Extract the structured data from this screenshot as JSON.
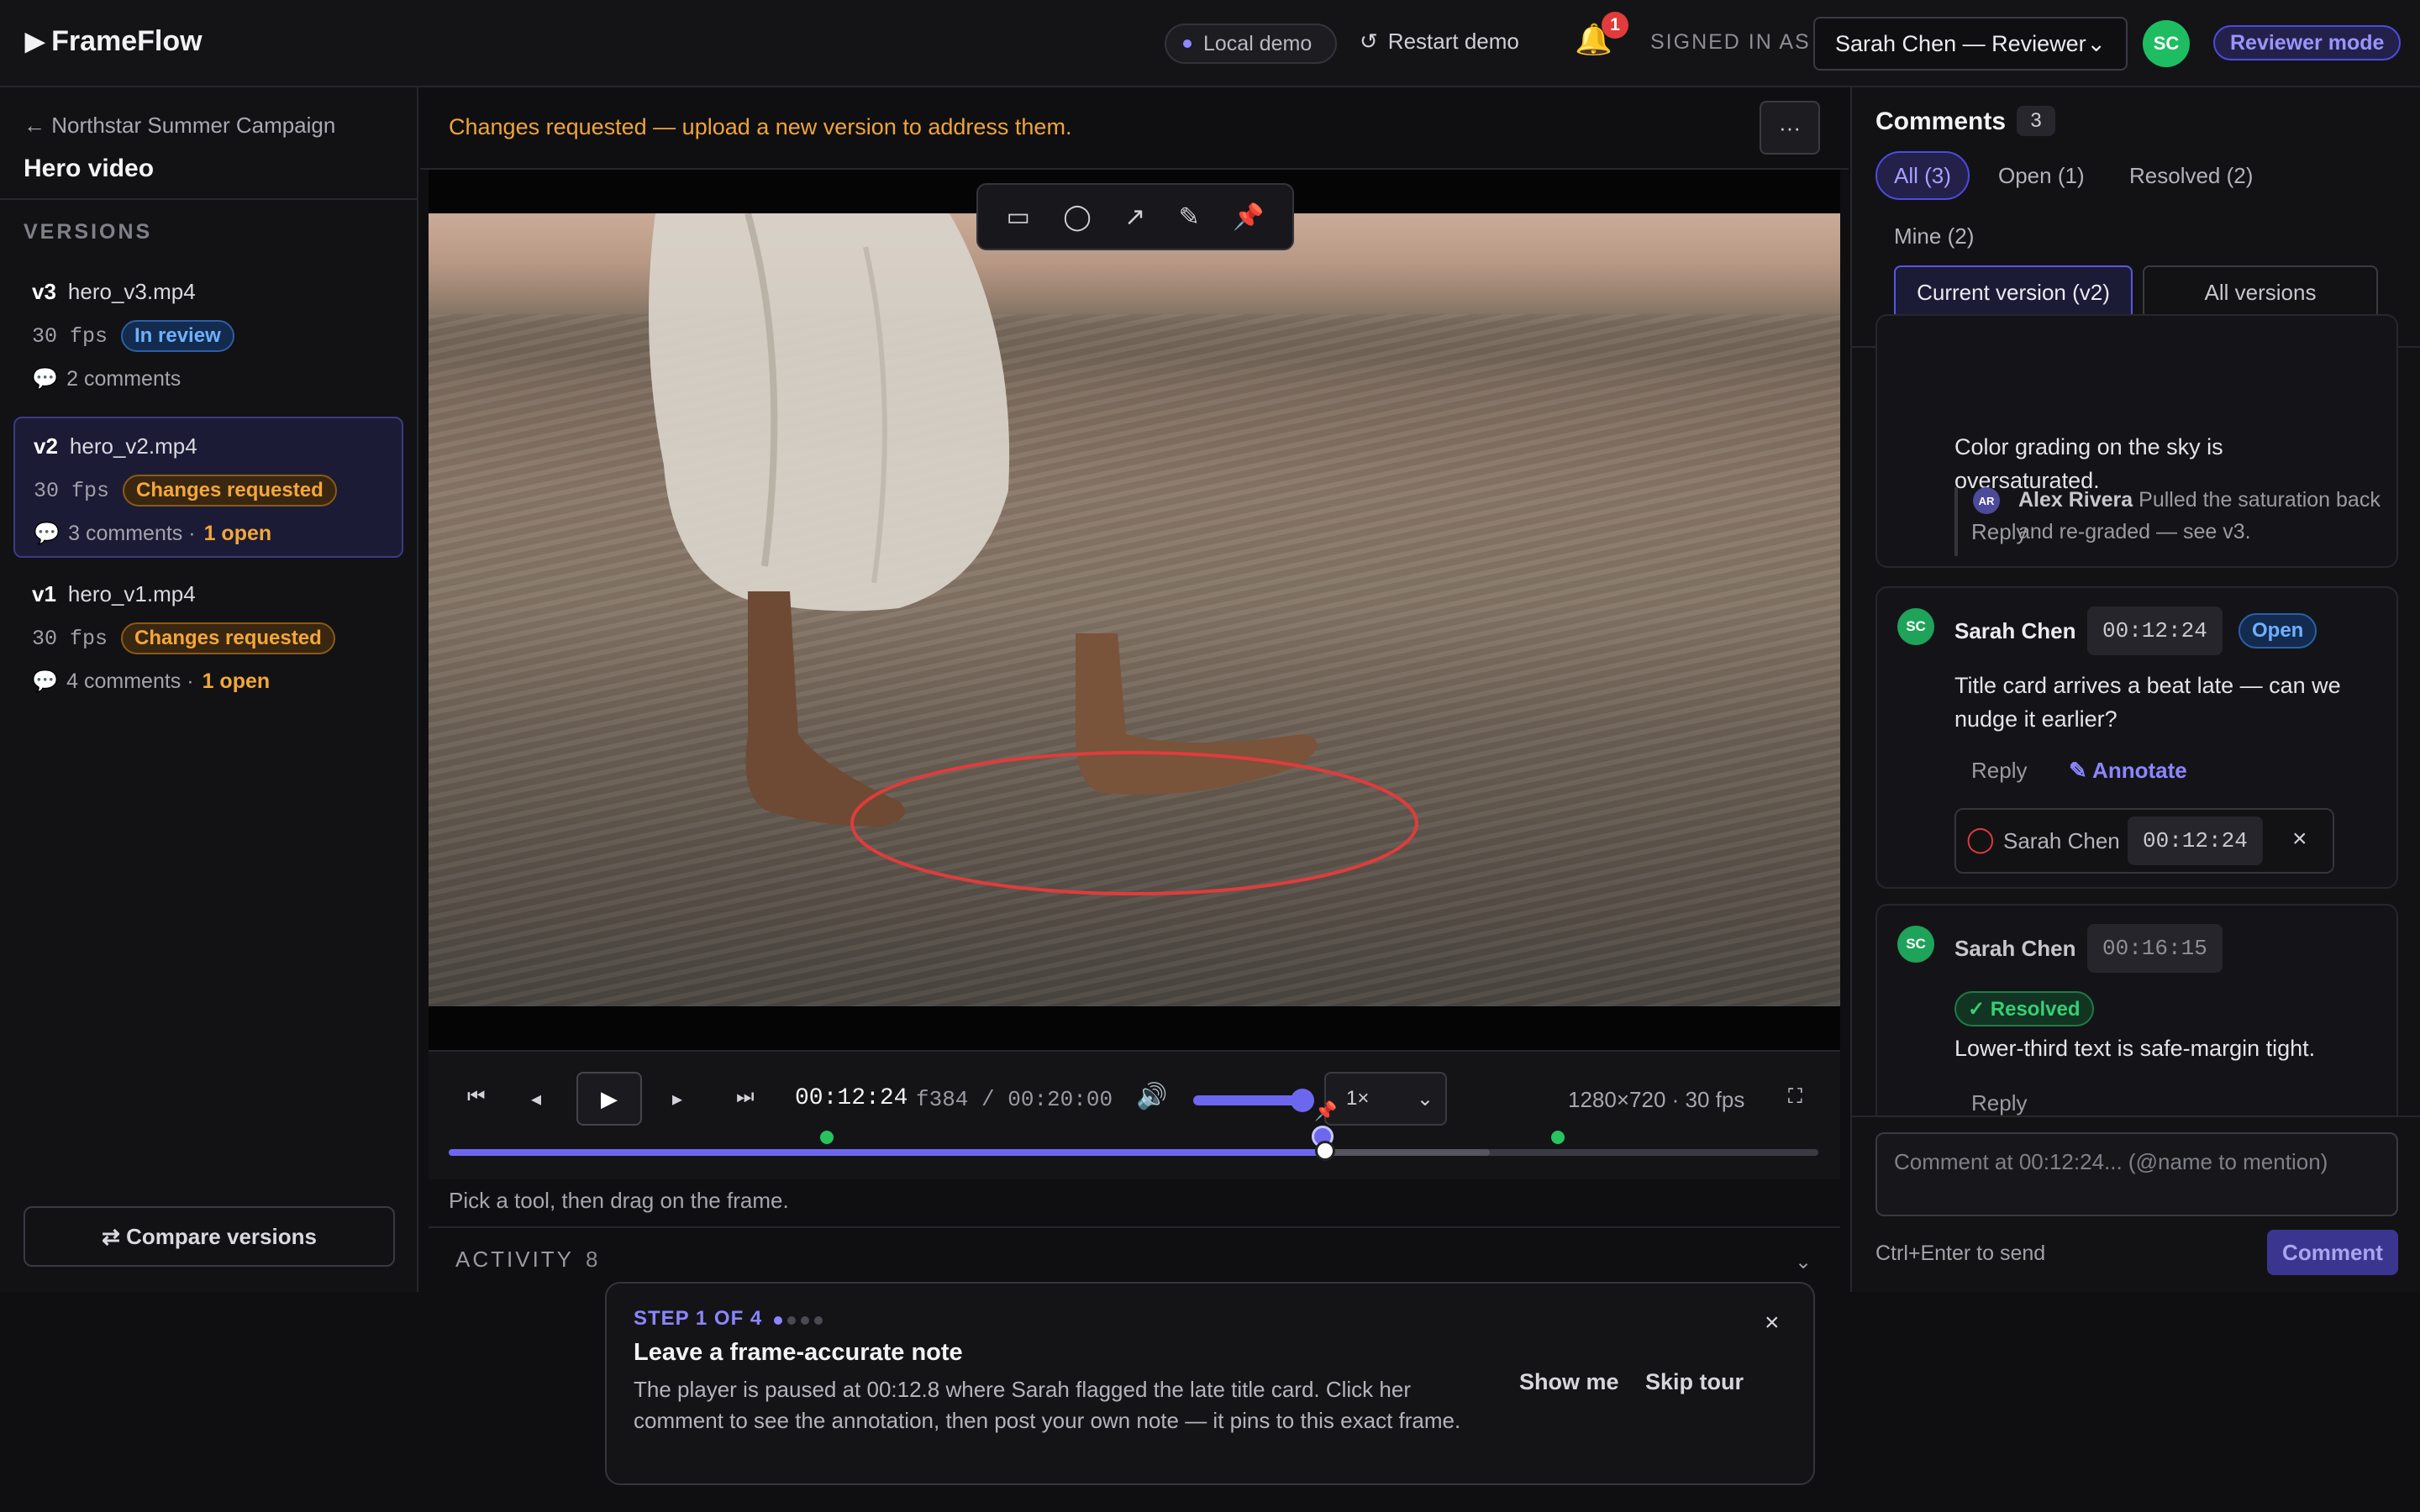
{
  "header": {
    "brand": "FrameFlow",
    "local_demo": "Local demo",
    "restart_demo": "Restart demo",
    "notifications_count": "1",
    "signed_in_label": "SIGNED IN AS",
    "user_select_value": "Sarah Chen — Reviewer",
    "avatar_initials": "SC",
    "mode_badge": "Reviewer mode"
  },
  "sidebar": {
    "breadcrumb": "← Northstar Summer Campaign",
    "title": "Hero video",
    "versions_heading": "VERSIONS",
    "versions": [
      {
        "id": "v3",
        "file": "hero_v3.mp4",
        "fps": "30 fps",
        "status": "In review",
        "comments": "2 comments",
        "open": ""
      },
      {
        "id": "v2",
        "file": "hero_v2.mp4",
        "fps": "30 fps",
        "status": "Changes requested",
        "comments": "3 comments ·",
        "open": "1 open"
      },
      {
        "id": "v1",
        "file": "hero_v1.mp4",
        "fps": "30 fps",
        "status": "Changes requested",
        "comments": "4 comments ·",
        "open": "1 open"
      }
    ],
    "compare_button": "⇄ Compare versions"
  },
  "player": {
    "banner": "Changes requested — upload a new version to address them.",
    "more_button": "···",
    "tools": [
      "▭",
      "◯",
      "↗",
      "✎",
      "📌"
    ],
    "timecode": "00:12:24",
    "frame": "f384",
    "duration": "/ 00:20:00",
    "speed": "1×",
    "resolution": "1280×720 · 30 fps",
    "playback_fraction": 0.64,
    "hint": "Pick a tool, then drag on the frame.",
    "activity_label": "ACTIVITY",
    "activity_count": "8"
  },
  "comments": {
    "title": "Comments",
    "count": "3",
    "filters": [
      "All (3)",
      "Open (1)",
      "Resolved (2)",
      "Mine (2)"
    ],
    "scope": [
      "Current version (v2)",
      "All versions"
    ],
    "c0": {
      "text": "Color grading on the sky is oversaturated.",
      "reply": "Reply",
      "reply_author_initials": "AR",
      "reply_author": "Alex Rivera",
      "reply_text": "Pulled the saturation back and re-graded — see v3."
    },
    "c1": {
      "initials": "SC",
      "author": "Sarah Chen",
      "time": "00:12:24",
      "status": "Open",
      "text": "Title card arrives a beat late — can we nudge it earlier?",
      "reply": "Reply",
      "annotate": "✎ Annotate",
      "chip_author": "Sarah Chen",
      "chip_time": "00:12:24",
      "chip_close": "×"
    },
    "c2": {
      "initials": "SC",
      "author": "Sarah Chen",
      "time": "00:16:15",
      "status": "✓ Resolved",
      "text": "Lower-third text is safe-margin tight.",
      "reply": "Reply"
    },
    "composer_placeholder": "Comment at 00:12:24... (@name to mention)",
    "send_hint": "Ctrl+Enter to send",
    "send_button": "Comment"
  },
  "tour": {
    "step": "STEP 1 OF 4",
    "title": "Leave a frame-accurate note",
    "body": "The player is paused at 00:12.8 where Sarah flagged the late title card. Click her comment to see the annotation, then post your own note — it pins to this exact frame.",
    "show_me": "Show me",
    "skip": "Skip tour",
    "close": "×"
  },
  "colors": {
    "accent": "#6d67f0",
    "warning": "#f3a73a",
    "success": "#27c45e",
    "annotation": "#e03c3c"
  }
}
